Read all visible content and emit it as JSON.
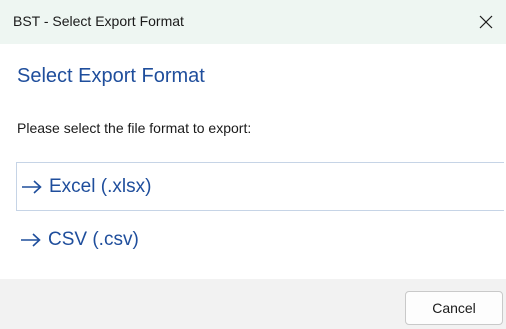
{
  "window": {
    "title": "BST - Select Export Format",
    "close_icon": "close-icon"
  },
  "dialog": {
    "heading": "Select Export Format",
    "instruction": "Please select the file format to export:",
    "options": [
      {
        "label": "Excel (.xlsx)",
        "icon": "arrow-right-icon",
        "state": "hovered"
      },
      {
        "label": "CSV (.csv)",
        "icon": "arrow-right-icon",
        "state": "normal"
      }
    ],
    "cancel_label": "Cancel"
  },
  "colors": {
    "titlebar_bg": "#eef6f2",
    "accent": "#1f4e9c",
    "footer_bg": "#f2f2f2"
  }
}
